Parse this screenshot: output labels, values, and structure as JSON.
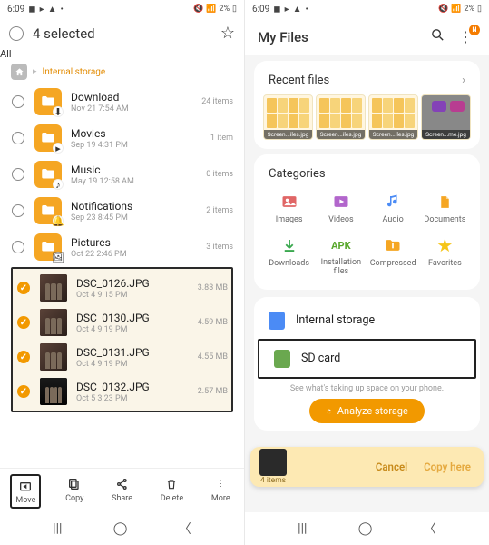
{
  "left": {
    "status": {
      "time": "6:09",
      "battery": "2%"
    },
    "header": {
      "all": "All",
      "title": "4 selected"
    },
    "breadcrumb": "Internal storage",
    "folders": [
      {
        "name": "Download",
        "sub": "Nov 21 7:54 AM",
        "meta": "24 items"
      },
      {
        "name": "Movies",
        "sub": "Sep 19 4:31 PM",
        "meta": "1 item"
      },
      {
        "name": "Music",
        "sub": "May 19 12:58 AM",
        "meta": "0 items"
      },
      {
        "name": "Notifications",
        "sub": "Sep 23 8:45 PM",
        "meta": "2 items"
      },
      {
        "name": "Pictures",
        "sub": "Oct 22 2:46 PM",
        "meta": "3 items"
      }
    ],
    "files": [
      {
        "name": "DSC_0126.JPG",
        "sub": "Oct 4 9:15 PM",
        "meta": "3.83 MB"
      },
      {
        "name": "DSC_0130.JPG",
        "sub": "Oct 4 9:19 PM",
        "meta": "4.59 MB"
      },
      {
        "name": "DSC_0131.JPG",
        "sub": "Oct 4 9:19 PM",
        "meta": "4.55 MB"
      },
      {
        "name": "DSC_0132.JPG",
        "sub": "Oct 5 3:23 PM",
        "meta": "2.57 MB"
      }
    ],
    "bottombar": {
      "move": "Move",
      "copy": "Copy",
      "share": "Share",
      "delete": "Delete",
      "more": "More"
    }
  },
  "right": {
    "status": {
      "time": "6:09",
      "battery": "2%"
    },
    "title": "My Files",
    "recent": {
      "title": "Recent files",
      "items": [
        {
          "label": "Screen...iles.jpg"
        },
        {
          "label": "Screen...iles.jpg"
        },
        {
          "label": "Screen...iles.jpg"
        },
        {
          "label": "Screen...me.jpg"
        }
      ]
    },
    "categories": {
      "title": "Categories",
      "items": [
        {
          "label": "Images"
        },
        {
          "label": "Videos"
        },
        {
          "label": "Audio"
        },
        {
          "label": "Documents"
        },
        {
          "label": "Downloads"
        },
        {
          "label": "Installation files",
          "apk": "APK"
        },
        {
          "label": "Compressed"
        },
        {
          "label": "Favorites"
        }
      ]
    },
    "storage": {
      "internal": "Internal storage",
      "sd": "SD card",
      "hint": "See what's taking up space on your phone.",
      "analyze": "Analyze storage"
    },
    "copybar": {
      "count": "4 items",
      "cancel": "Cancel",
      "copy": "Copy here"
    }
  }
}
